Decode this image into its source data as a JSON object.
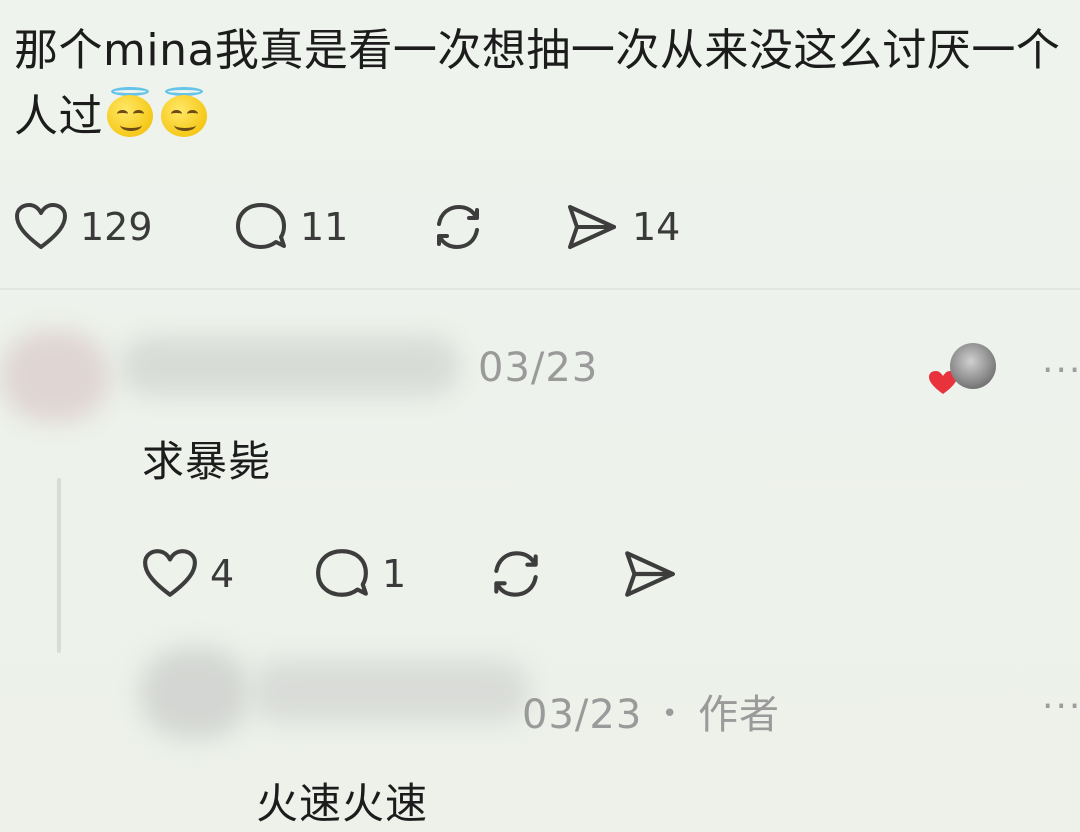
{
  "post": {
    "text": "那个mina我真是看一次想抽一次从来没这么讨厌一个人过",
    "emoji": "smiling-face-with-halo",
    "likes": "129",
    "comments": "11",
    "shares": "14"
  },
  "comment1": {
    "date": "03/23",
    "text": "求暴毙",
    "likes": "4",
    "replies": "1",
    "more": "···"
  },
  "comment2": {
    "date": "03/23",
    "author_tag": "作者",
    "separator": "•",
    "text": "火速火速",
    "more": "···"
  },
  "colors": {
    "background": "#eef2ec",
    "text": "#1c1c1c",
    "muted": "#9a9a9a",
    "heart_badge": "#e8323c"
  }
}
